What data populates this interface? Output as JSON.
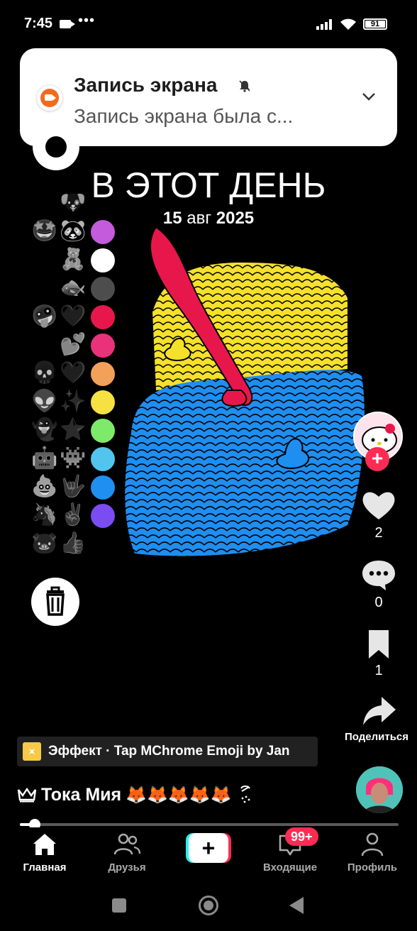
{
  "status_bar": {
    "time": "7:45",
    "dots": "•••",
    "battery": "91"
  },
  "notification": {
    "title": "Запись экрана",
    "text": "Запись экрана была с..."
  },
  "video": {
    "title": "В ЭТОТ ДЕНЬ",
    "date_day": "15",
    "date_month": "авг",
    "date_year": "2025"
  },
  "palette": {
    "emoji_left": [
      "😊",
      "🤩",
      "😘",
      "😍",
      "🤪",
      "😊",
      "💀",
      "👽",
      "👻",
      "🤖",
      "💩",
      "🦄",
      "🐷"
    ],
    "emoji_right": [
      "🐶",
      "🐼",
      "🧸",
      "🐟",
      "🤍",
      "💕",
      "🤍",
      "✨",
      "⭐",
      "👾",
      "🤟",
      "✌️",
      "👍"
    ],
    "colors": [
      "#c45bdc",
      "#ffffff",
      "#4d4d4d",
      "#e8174b",
      "#e9327a",
      "#f2a05a",
      "#f5e142",
      "#7dea6a",
      "#52c4ee",
      "#1f8ff0",
      "#7a4cf2"
    ]
  },
  "right_rail": {
    "likes": "2",
    "comments": "0",
    "bookmarks": "1",
    "share_label": "Поделиться"
  },
  "effect": {
    "label": "Эффект · Tap MChrome Emoji by Jan"
  },
  "caption": {
    "name": "Тока Мия",
    "emojis": "🦊🦊🦊🦊🦊"
  },
  "progress": {
    "fraction": 0.04
  },
  "bottom_nav": {
    "items": [
      {
        "label": "Главная",
        "icon": "home-icon",
        "active": true
      },
      {
        "label": "Друзья",
        "icon": "friends-icon",
        "active": false
      },
      {
        "label": "Входящие",
        "icon": "inbox-icon",
        "active": false
      },
      {
        "label": "Профиль",
        "icon": "profile-icon",
        "active": false
      }
    ],
    "create_label": "+",
    "inbox_badge": "99+"
  },
  "colors": {
    "accent": "#fe2c55",
    "teal": "#25f4ee"
  }
}
